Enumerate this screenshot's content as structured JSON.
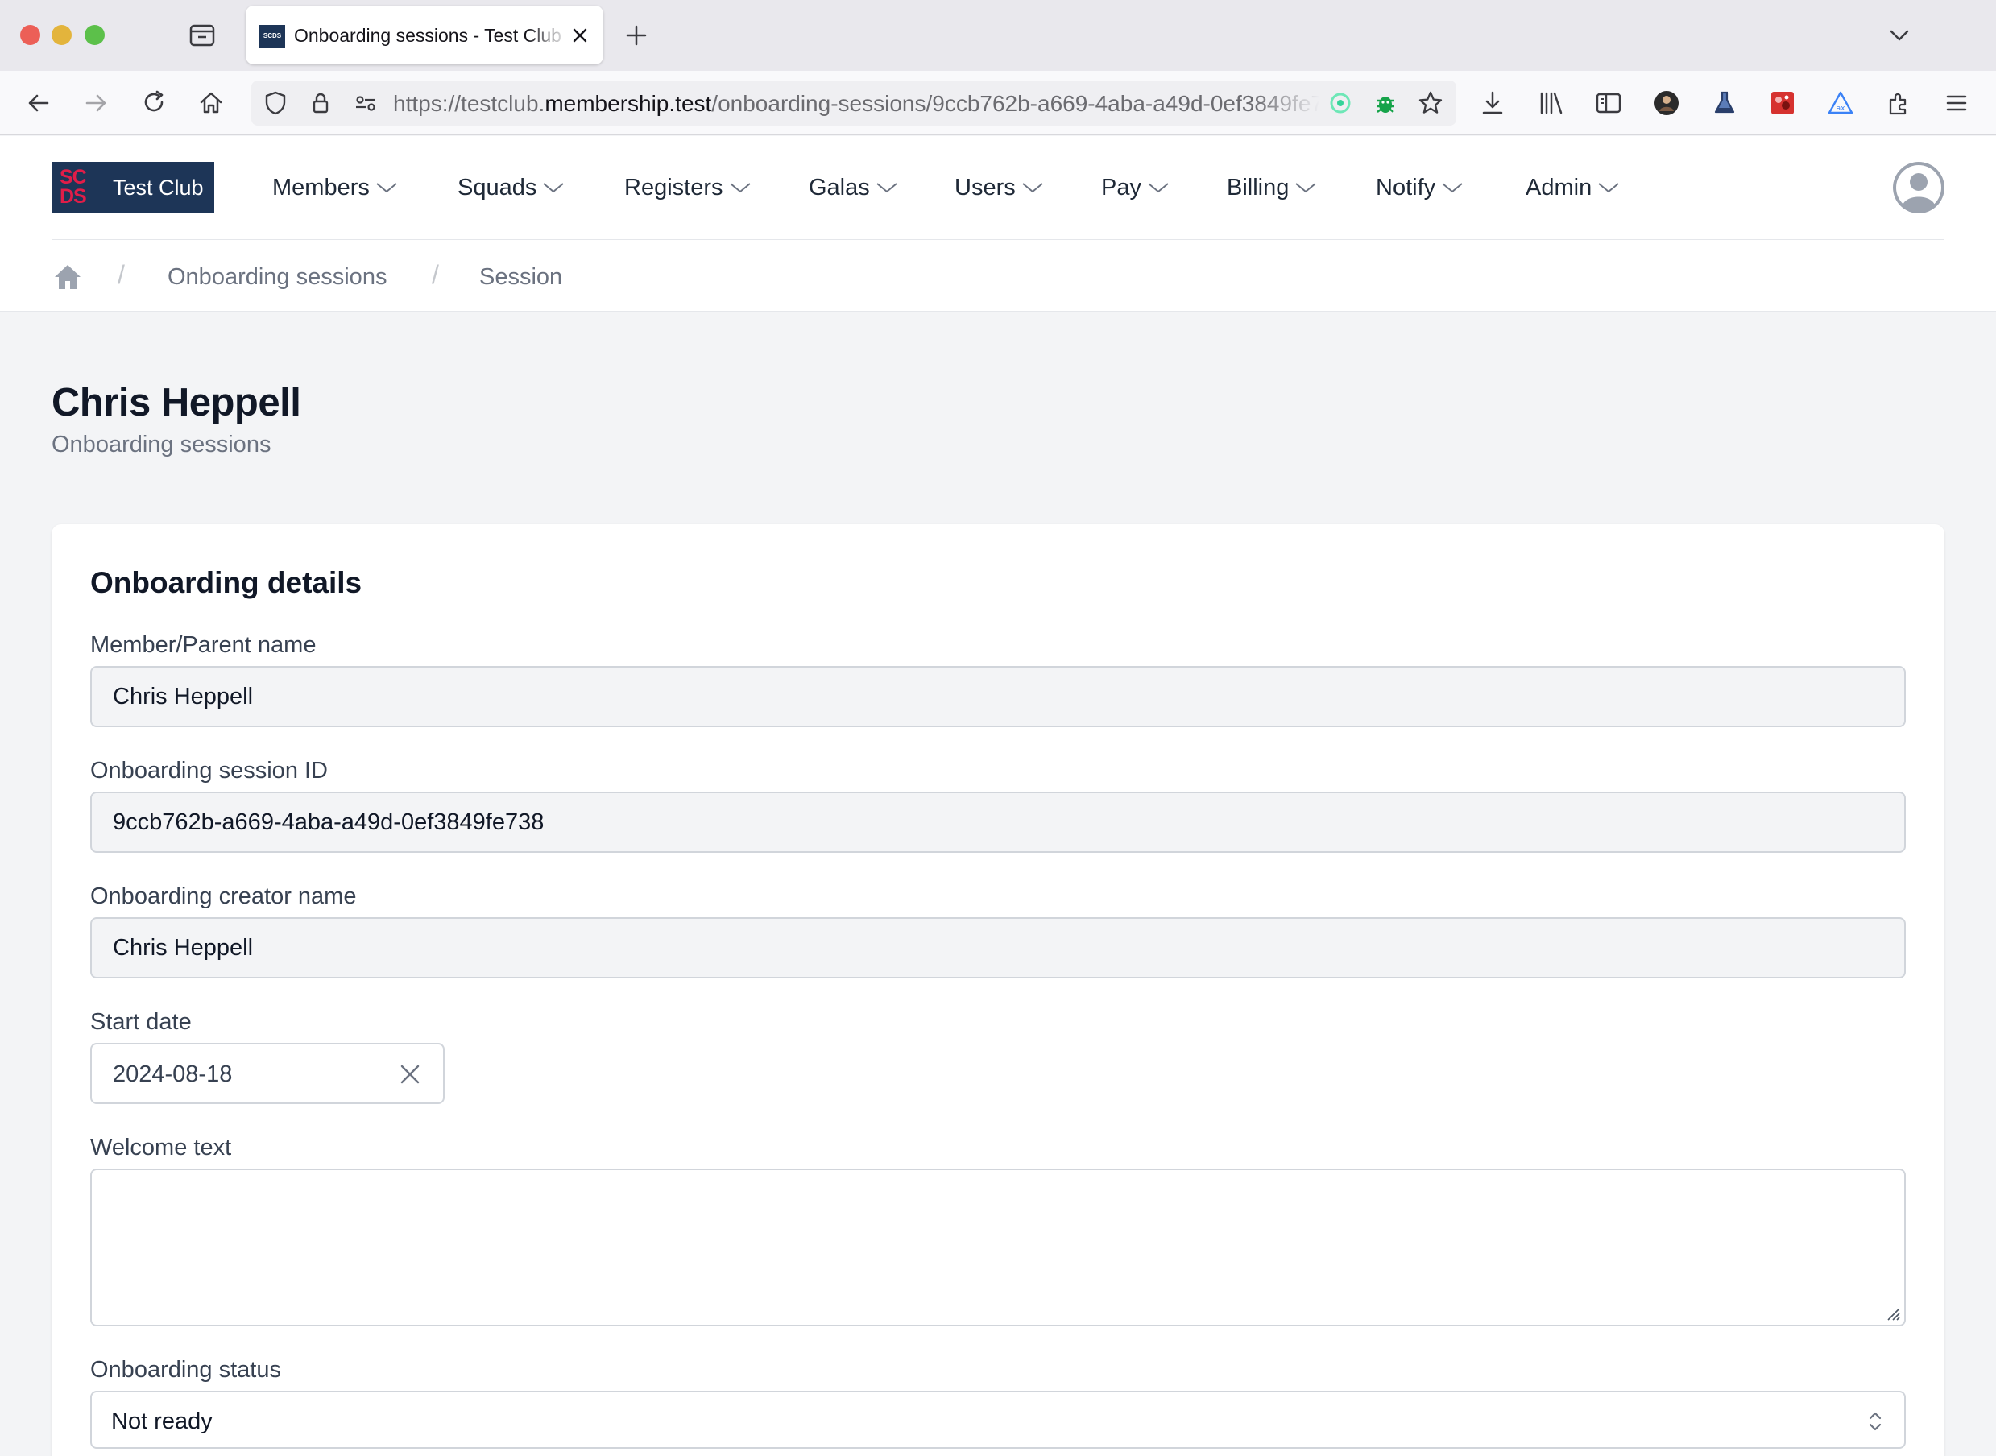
{
  "browser": {
    "tab_title": "Onboarding sessions - Test Club",
    "favicon_text": "SCDS",
    "url_prefix": "https://testclub.",
    "url_host": "membership.test",
    "url_path": "/onboarding-sessions/9ccb762b-a669-4aba-a49d-0ef3849fe738"
  },
  "site": {
    "brand_mark_top": "SC",
    "brand_mark_bottom": "DS",
    "brand_name": "Test Club",
    "menu": [
      "Members",
      "Squads",
      "Registers",
      "Galas",
      "Users",
      "Pay",
      "Billing",
      "Notify",
      "Admin"
    ],
    "breadcrumb": [
      "Onboarding sessions",
      "Session"
    ]
  },
  "page": {
    "title": "Chris Heppell",
    "subtitle": "Onboarding sessions"
  },
  "form": {
    "card_title": "Onboarding details",
    "member_name_label": "Member/Parent name",
    "member_name_value": "Chris Heppell",
    "session_id_label": "Onboarding session ID",
    "session_id_value": "9ccb762b-a669-4aba-a49d-0ef3849fe738",
    "creator_label": "Onboarding creator name",
    "creator_value": "Chris Heppell",
    "start_date_label": "Start date",
    "start_date_value": "2024-08-18",
    "welcome_label": "Welcome text",
    "welcome_value": "",
    "status_label": "Onboarding status",
    "status_value": "Not ready"
  },
  "colors": {
    "brand_bg": "#1d3557",
    "brand_mark": "#e11d48",
    "page_bg": "#f3f4f6"
  },
  "icons": [
    "back-icon",
    "forward-icon",
    "reload-icon",
    "home-icon",
    "shield-icon",
    "lock-icon",
    "permissions-icon",
    "star-icon",
    "download-icon",
    "library-icon",
    "sidebar-icon",
    "extensions-icon",
    "menu-icon"
  ]
}
